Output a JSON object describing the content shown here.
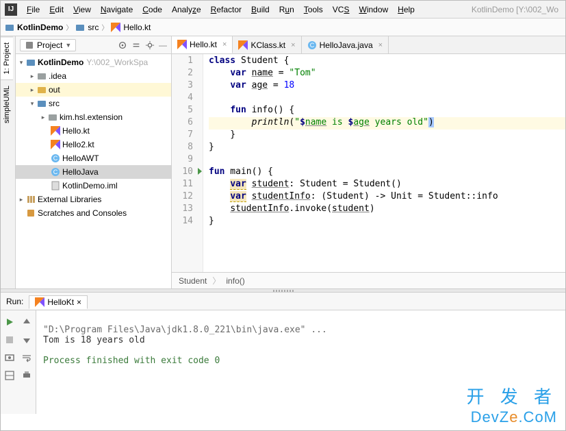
{
  "window": {
    "project_hint": "KotlinDemo [Y:\\002_Wo"
  },
  "menus": {
    "file": "File",
    "edit": "Edit",
    "view": "View",
    "navigate": "Navigate",
    "code": "Code",
    "analyze": "Analyze",
    "refactor": "Refactor",
    "build": "Build",
    "run": "Run",
    "tools": "Tools",
    "vcs": "VCS",
    "window": "Window",
    "help": "Help"
  },
  "breadcrumbs": {
    "root": "KotlinDemo",
    "src": "src",
    "file": "Hello.kt"
  },
  "side_tabs": {
    "project": "1: Project",
    "uml": "simpleUML"
  },
  "project_panel": {
    "dropdown": "Project",
    "tree": {
      "root": {
        "label": "KotlinDemo",
        "meta": "Y:\\002_WorkSpa"
      },
      "idea": ".idea",
      "out": "out",
      "src": "src",
      "pkg": "kim.hsl.extension",
      "f_hello": "Hello.kt",
      "f_hello2": "Hello2.kt",
      "f_awt": "HelloAWT",
      "f_java": "HelloJava",
      "f_iml": "KotlinDemo.iml",
      "ext_lib": "External Libraries",
      "scratches": "Scratches and Consoles"
    }
  },
  "editor_tabs": {
    "t1": "Hello.kt",
    "t2": "KClass.kt",
    "t3": "HelloJava.java"
  },
  "code_lines": {
    "l1": "class Student {",
    "l2": "    var name = \"Tom\"",
    "l3": "    var age = 18",
    "l4": "",
    "l5": "    fun info() {",
    "l6": "        println(\"$name is $age years old\")",
    "l7": "    }",
    "l8": "}",
    "l9": "",
    "l10": "fun main() {",
    "l11": "    var student: Student = Student()",
    "l12": "    var studentInfo: (Student) -> Unit = Student::info",
    "l13": "    studentInfo.invoke(student)",
    "l14": "}"
  },
  "line_numbers": [
    "1",
    "2",
    "3",
    "4",
    "5",
    "6",
    "7",
    "8",
    "9",
    "10",
    "11",
    "12",
    "13",
    "14"
  ],
  "editor_bc": {
    "a": "Student",
    "b": "info()"
  },
  "run": {
    "label": "Run:",
    "tab": "HelloKt",
    "out1": "\"D:\\Program Files\\Java\\jdk1.8.0_221\\bin\\java.exe\" ...",
    "out2": "Tom is 18 years old",
    "out3": "Process finished with exit code 0"
  },
  "watermark": {
    "line1": "开 发 者",
    "line2a": "DevZ",
    "line2b": "e",
    "line2c": ".CoM"
  }
}
